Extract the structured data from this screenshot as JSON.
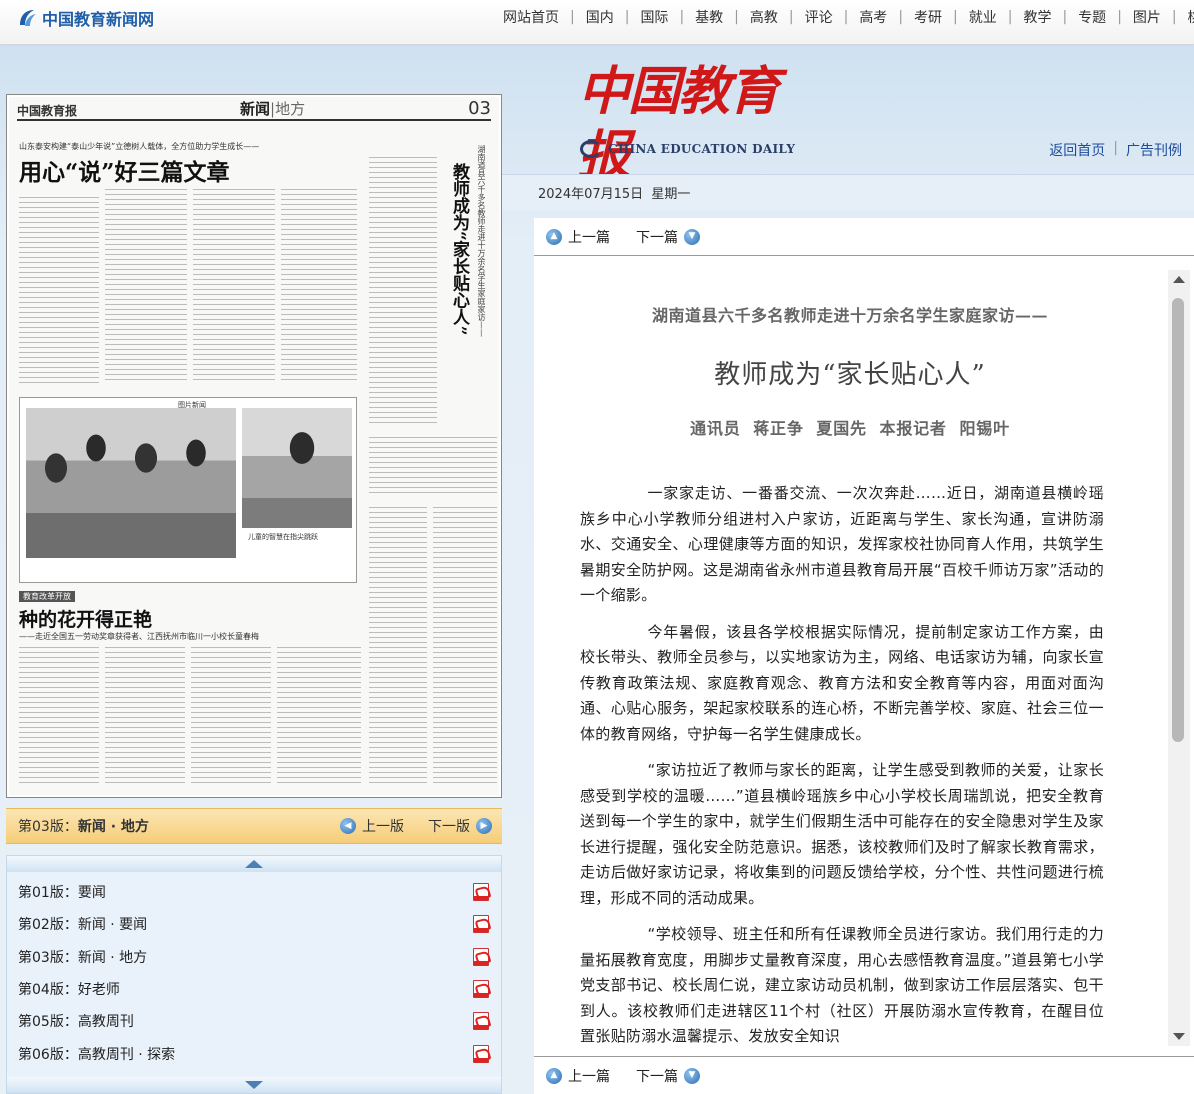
{
  "site": {
    "logo_text": "中国教育新闻网",
    "nav": [
      "网站首页",
      "国内",
      "国际",
      "基教",
      "高教",
      "评论",
      "高考",
      "考研",
      "就业",
      "教学",
      "专题",
      "图片",
      "桃李"
    ]
  },
  "masthead": {
    "name_cn": "中国教育报",
    "name_en": "CHINA EDUCATION DAILY",
    "back_home": "返回首页",
    "ads": "广告刊例",
    "date": "2024年07月15日  星期一"
  },
  "newspaper_page": {
    "paper_name": "中国教育报",
    "section": "新闻",
    "section_sub": "地方",
    "page_num": "03",
    "kicker1": "山东泰安构建“泰山少年说”立德树人载体，全方位助力学生成长——",
    "title1": "用心“说”好三篇文章",
    "vtitle": "教师成为“家长贴心人”",
    "vsub": "湖南道县六千多名教师走进十万余名学生家庭家访——",
    "vkicker": "图片新闻",
    "photo_title": "图片新闻",
    "photo_caption2": "儿童的智慧在指尖跳跃",
    "tag": "教育改革开放",
    "title2": "种的花开得正艳",
    "sub2": "——走近全国五一劳动奖章获得者、江西抚州市临川一小校长童春梅"
  },
  "section_bar": {
    "current_prefix": "第03版：",
    "current_name": "新闻 · 地方",
    "prev": "上一版",
    "next": "下一版"
  },
  "editions": [
    {
      "label": "第01版：要闻"
    },
    {
      "label": "第02版：新闻 · 要闻"
    },
    {
      "label": "第03版：新闻 · 地方"
    },
    {
      "label": "第04版：好老师"
    },
    {
      "label": "第05版：高教周刊"
    },
    {
      "label": "第06版：高教周刊 · 探索"
    }
  ],
  "article": {
    "prev": "上一篇",
    "next": "下一篇",
    "kicker": "湖南道县六千多名教师走进十万余名学生家庭家访——",
    "title": "教师成为“家长贴心人”",
    "byline": "通讯员  蒋正争  夏国先  本报记者  阳锡叶",
    "paragraphs": [
      "一家家走访、一番番交流、一次次奔赴……近日，湖南道县横岭瑶族乡中心小学教师分组进村入户家访，近距离与学生、家长沟通，宣讲防溺水、交通安全、心理健康等方面的知识，发挥家校社协同育人作用，共筑学生暑期安全防护网。这是湖南省永州市道县教育局开展“百校千师访万家”活动的一个缩影。",
      "今年暑假，该县各学校根据实际情况，提前制定家访工作方案，由校长带头、教师全员参与，以实地家访为主，网络、电话家访为辅，向家长宣传教育政策法规、家庭教育观念、教育方法和安全教育等内容，用面对面沟通、心贴心服务，架起家校联系的连心桥，不断完善学校、家庭、社会三位一体的教育网络，守护每一名学生健康成长。",
      "“家访拉近了教师与家长的距离，让学生感受到教师的关爱，让家长感受到学校的温暖……”道县横岭瑶族乡中心小学校长周瑞凯说，把安全教育送到每一个学生的家中，就学生们假期生活中可能存在的安全隐患对学生及家长进行提醒，强化安全防范意识。据悉，该校教师们及时了解家长教育需求，走访后做好家访记录，将收集到的问题反馈给学校，分个性、共性问题进行梳理，形成不同的活动成果。",
      "“学校领导、班主任和所有任课教师全员进行家访。我们用行走的力量拓展教育宽度，用脚步丈量教育深度，用心去感悟教育温度。”道县第七小学党支部书记、校长周仁说，建立家访动员机制，做到家访工作层层落实、包干到人。该校教师们走进辖区11个村（社区）开展防溺水宣传教育，在醒目位置张贴防溺水温馨提示、发放安全知识"
    ]
  }
}
